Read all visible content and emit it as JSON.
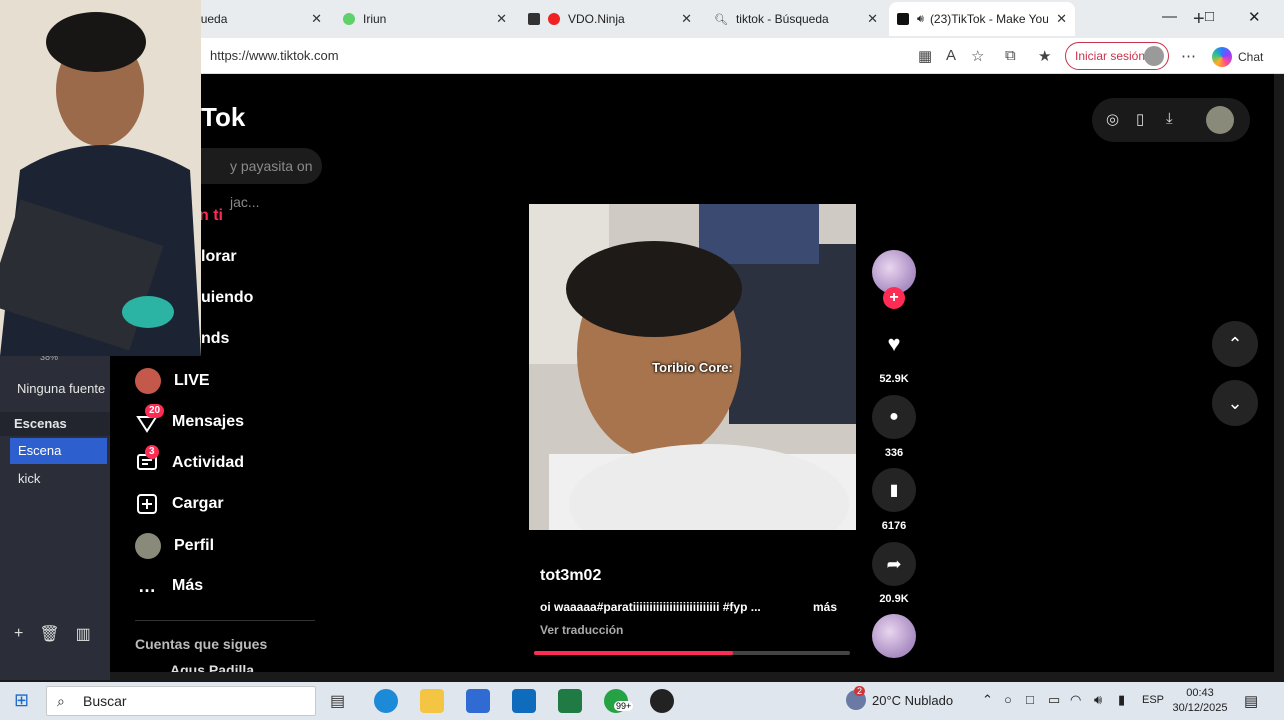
{
  "obs": {
    "percent_label": "38%",
    "source_label": "Ninguna fuente",
    "scenes_header": "Escenas",
    "scenes": [
      "Escena",
      "kick"
    ]
  },
  "browser": {
    "tabs": [
      {
        "title": "webcam - Búsqueda"
      },
      {
        "title": "Iriun"
      },
      {
        "title": "VDO.Ninja"
      },
      {
        "title": "tiktok - Búsqueda"
      },
      {
        "title": "(23)TikTok - Make You"
      }
    ],
    "url": "https://www.tiktok.com",
    "signin_label": "Iniciar sesión",
    "chat_label": "Chat"
  },
  "tiktok": {
    "logo_text": "Tok",
    "search_placeholder": "y payasita on jac...",
    "nav": {
      "for_you": "n ti",
      "explore": "lorar",
      "following": "uiendo",
      "friends": "nds",
      "live": "LIVE",
      "messages": "Mensajes",
      "messages_badge": "20",
      "activity": "Actividad",
      "activity_badge": "3",
      "upload": "Cargar",
      "profile": "Perfil",
      "more": "Más"
    },
    "following_header": "Cuentas que sigues",
    "following_first": "Agus Padilla",
    "video": {
      "caption_overlay": "Toribio Core:",
      "author": "tot3m02",
      "description": "oi waaaaa#paratiiiiiiiiiiiiiiiiiiiiiiiiii #fyp ...",
      "more_label": "más",
      "translate_label": "Ver traducción",
      "progress": 0.63
    },
    "actions": {
      "likes": "52.9K",
      "comments": "336",
      "saves": "6176",
      "shares": "20.9K"
    }
  },
  "taskbar": {
    "search_placeholder": "Buscar",
    "whatsapp_badge": "99+",
    "weather_badge": "2",
    "weather": "20°C  Nublado",
    "language": "ESP",
    "time": "00:43",
    "date": "30/12/2025"
  }
}
